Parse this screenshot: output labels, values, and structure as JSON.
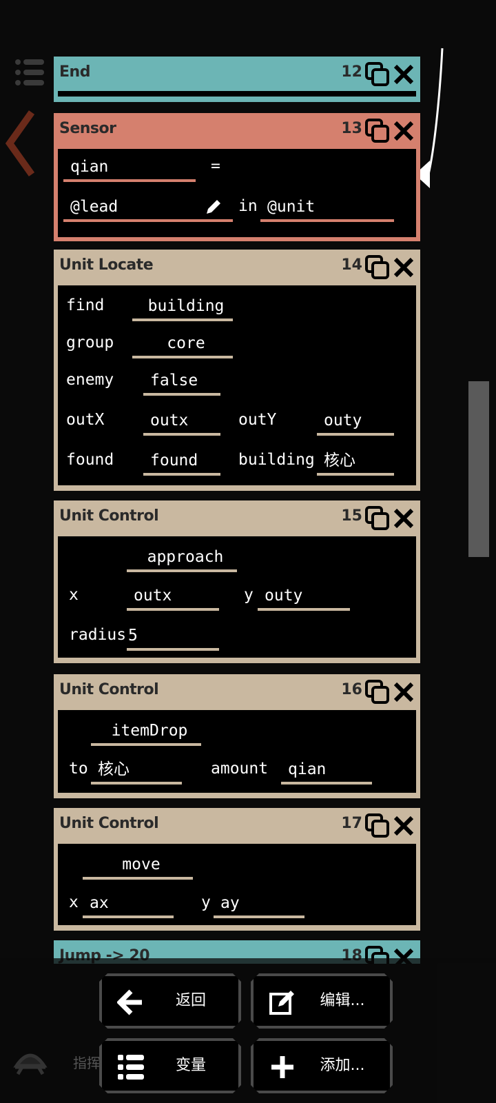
{
  "blocks": [
    {
      "title": "End",
      "num": "12"
    },
    {
      "title": "Sensor",
      "num": "13",
      "result": "qian",
      "equals": "=",
      "sensor": "@lead",
      "in": "in",
      "target": "@unit"
    },
    {
      "title": "Unit Locate",
      "num": "14",
      "rows": {
        "find_label": "find",
        "find": "building",
        "group_label": "group",
        "group": "core",
        "enemy_label": "enemy",
        "enemy": "false",
        "outx_label": "outX",
        "outx": "outx",
        "outy_label": "outY",
        "outy": "outy",
        "found_label": "found",
        "found": "found",
        "building_label": "building",
        "building": "核心"
      }
    },
    {
      "title": "Unit Control",
      "num": "15",
      "action": "approach",
      "x_label": "x",
      "x": "outx",
      "y_label": "y",
      "y": "outy",
      "radius_label": "radius",
      "radius": "5"
    },
    {
      "title": "Unit Control",
      "num": "16",
      "action": "itemDrop",
      "to_label": "to",
      "to": "核心",
      "amount_label": "amount",
      "amount": "qian"
    },
    {
      "title": "Unit Control",
      "num": "17",
      "action": "move",
      "x_label": "x",
      "x": "ax",
      "y_label": "y",
      "y": "ay"
    },
    {
      "title": "Jump -> 20",
      "num": "18"
    }
  ],
  "buttons": {
    "back": "返回",
    "edit": "编辑...",
    "variables": "变量",
    "add": "添加..."
  },
  "bg_hint": "指挥",
  "colors": {
    "teal": "#6cb5b5",
    "salmon": "#d5806e",
    "tan": "#c9b8a0"
  },
  "icons": [
    "menu-icon",
    "copy-icon",
    "close-icon",
    "pencil-icon",
    "back-arrow-icon",
    "edit-icon",
    "list-icon",
    "plus-icon"
  ]
}
